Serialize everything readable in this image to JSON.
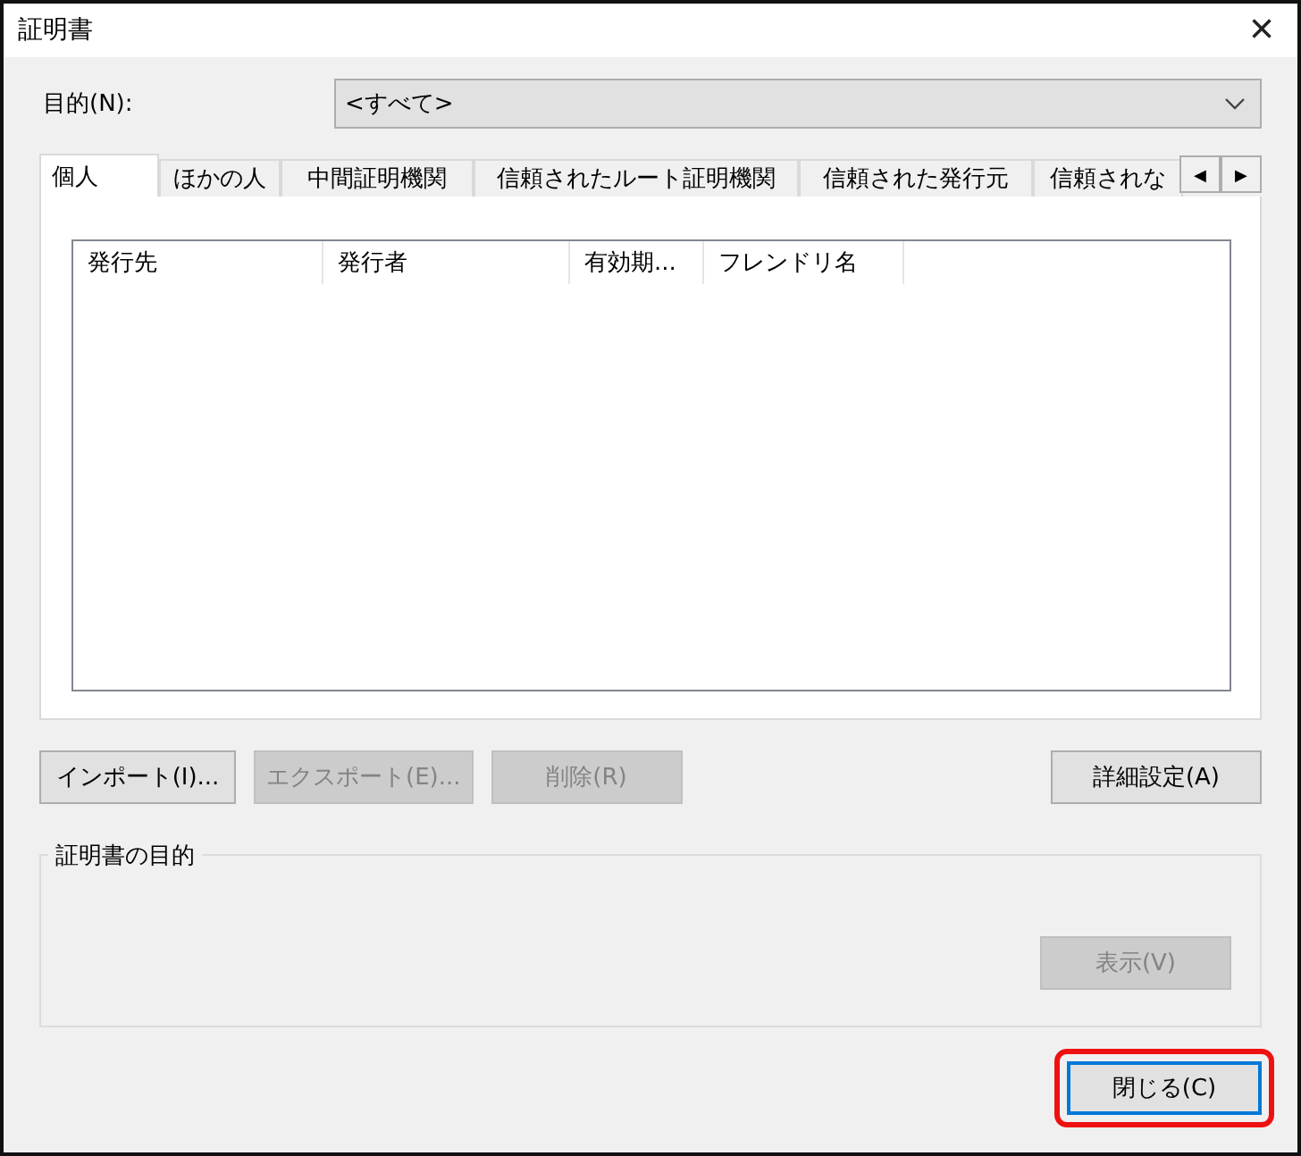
{
  "window": {
    "title": "証明書",
    "close": "×"
  },
  "purpose": {
    "label": "目的(N):",
    "value": "<すべて>"
  },
  "tabs": [
    {
      "label": "個人",
      "selected": true
    },
    {
      "label": "ほかの人",
      "selected": false
    },
    {
      "label": "中間証明機関",
      "selected": false
    },
    {
      "label": "信頼されたルート証明機関",
      "selected": false
    },
    {
      "label": "信頼された発行元",
      "selected": false
    },
    {
      "label": "信頼されな",
      "selected": false
    }
  ],
  "tab_scroll": [
    "◀",
    "▶"
  ],
  "table": {
    "columns": [
      "発行先",
      "発行者",
      "有効期...",
      "フレンドリ名"
    ]
  },
  "buttons": [
    {
      "label": "インポート(I)...",
      "disabled": false
    },
    {
      "label": "エクスポート(E)...",
      "disabled": true
    },
    {
      "label": "削除(R)",
      "disabled": true
    },
    {
      "label": "詳細設定(A)",
      "disabled": false
    }
  ],
  "purpose_group": {
    "title": "証明書の目的",
    "view_button": {
      "label": "表示(V)",
      "disabled": true
    }
  },
  "close_button": {
    "label": "閉じる(C)",
    "highlighted": true
  }
}
